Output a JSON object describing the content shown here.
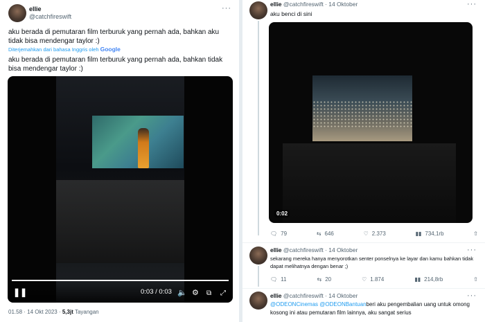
{
  "left_tweet": {
    "name": "ellie",
    "handle": "@catchfireswift",
    "text": "aku berada di pemutaran film terburuk yang pernah ada, bahkan aku tidak bisa mendengar taylor :)",
    "translated_note": "Diterjemahkan dari bahasa Inggris oleh",
    "translator": "Google",
    "translated_text": "aku berada di pemutaran film terburuk yang pernah ada, bahkan tidak bisa mendengar taylor :)",
    "video_time": "0:03 / 0:03",
    "timestamp": "01.58 · 14 Okt 2023 ·",
    "views_count": "5,3jt",
    "views_label": "Tayangan"
  },
  "right_tweets": [
    {
      "name": "ellie",
      "handle": "@catchfireswift · 14 Oktober",
      "text": "aku benci di sini",
      "video_timer": "0:02",
      "replies": "79",
      "retweets": "646",
      "likes": "2.373",
      "views": "734,1rb"
    },
    {
      "name": "ellie",
      "handle": "@catchfireswift · 14 Oktober",
      "text": "sekarang mereka hanya menyorotkan senter ponselnya ke layar dan kamu bahkan tidak dapat melihatnya dengan benar ;)",
      "replies": "11",
      "retweets": "20",
      "likes": "1.874",
      "views": "214,8rb"
    },
    {
      "name": "ellie",
      "handle": "@catchfireswift · 14 Oktober",
      "mention1": "@ODEONCinemas",
      "mention2": "@ODEONBantuan",
      "text": "beri aku pengembalian uang untuk omong kosong ini atau pemutaran film lainnya, aku sangat serius"
    }
  ],
  "colors": {
    "link": "#1d9bf0",
    "muted": "#536471"
  }
}
